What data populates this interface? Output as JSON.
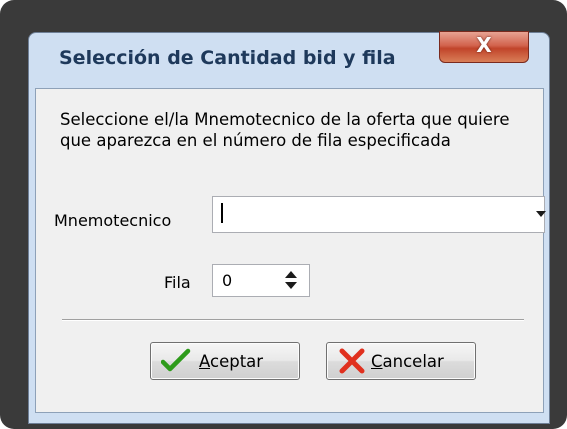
{
  "dialog": {
    "title": "Selección de Cantidad bid y fila",
    "close_label": "X",
    "description": "Seleccione el/la Mnemotecnico de la oferta que quiere que aparezca en el número de fila especificada",
    "mnemo_label": "Mnemotecnico",
    "mnemo_value": "",
    "fila_label": "Fila",
    "fila_value": "0"
  },
  "buttons": {
    "accept_mnemonic": "A",
    "accept_rest": "ceptar",
    "cancel_mnemonic": "C",
    "cancel_rest": "ancelar"
  },
  "colors": {
    "frame": "#3a3a3a",
    "window_chrome": "#cfdff2",
    "title_text": "#1e395b",
    "close_button": "#c1442a",
    "client_bg": "#f0f0f0",
    "accept_icon": "#2e9b1b",
    "cancel_icon": "#e0301e"
  },
  "icons": {
    "accept": "checkmark-icon",
    "cancel": "x-icon",
    "combo": "dropdown-arrow-icon",
    "spin": "spin-arrows-icon"
  }
}
